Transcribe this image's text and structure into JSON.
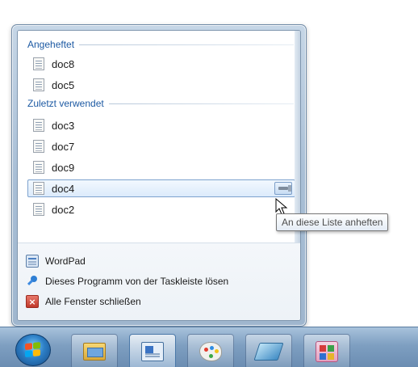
{
  "jumplist": {
    "pinned_header": "Angeheftet",
    "pinned_items": [
      {
        "label": "doc8"
      },
      {
        "label": "doc5"
      }
    ],
    "recent_header": "Zuletzt verwendet",
    "recent_items": [
      {
        "label": "doc3"
      },
      {
        "label": "doc7"
      },
      {
        "label": "doc9"
      },
      {
        "label": "doc4",
        "hovered": true
      },
      {
        "label": "doc2"
      }
    ],
    "tasks": [
      {
        "label": "WordPad",
        "icon": "wordpad-icon"
      },
      {
        "label": "Dieses Programm von der Taskleiste lösen",
        "icon": "unpin-icon"
      },
      {
        "label": "Alle Fenster schließen",
        "icon": "close-windows-icon"
      }
    ]
  },
  "tooltip": {
    "text": "An diese Liste anheften"
  },
  "taskbar": {
    "apps": [
      {
        "name": "windows-explorer",
        "icon": "folder-icon"
      },
      {
        "name": "wordpad",
        "icon": "wordpad-icon",
        "active": true
      },
      {
        "name": "paint",
        "icon": "paint-icon"
      },
      {
        "name": "windows-journal",
        "icon": "journal-icon"
      },
      {
        "name": "media-center",
        "icon": "media-icon"
      }
    ]
  },
  "colors": {
    "section_header": "#1d5aa3",
    "hover_border": "#7da2ce",
    "taskbar": "#7e9fc1"
  }
}
